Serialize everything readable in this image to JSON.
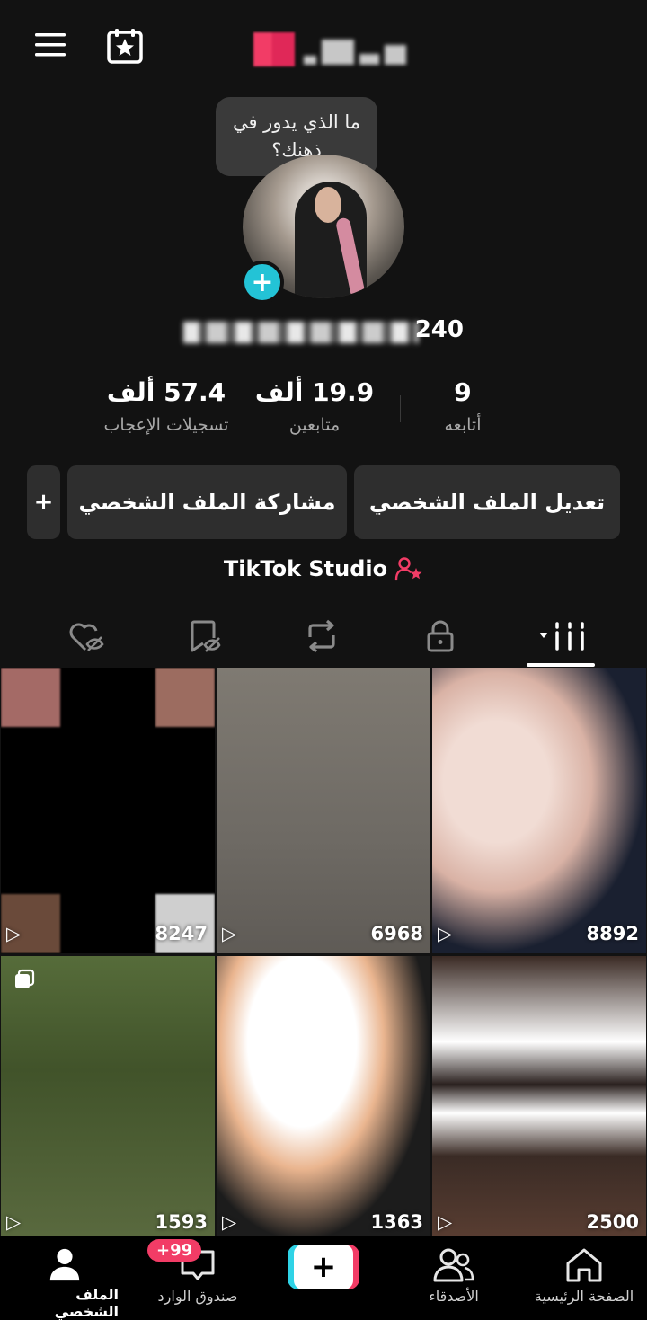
{
  "header": {
    "menu_icon": "hamburger-icon",
    "calendar_icon": "calendar-star-icon"
  },
  "profile": {
    "thought_bubble": "ما الذي يدور في ذهنك؟",
    "username_suffix": "240",
    "stats": [
      {
        "number": "9",
        "label": "أتابعه"
      },
      {
        "number": "19.9 ألف",
        "label": "متابعين"
      },
      {
        "number": "57.4 ألف",
        "label": "تسجيلات الإعجاب"
      }
    ],
    "buttons": {
      "edit": "تعديل الملف الشخصي",
      "share": "مشاركة الملف الشخصي",
      "more": "+"
    },
    "studio_label": "TikTok Studio"
  },
  "tabs": [
    {
      "name": "videos",
      "icon": "grid-bars-icon"
    },
    {
      "name": "private",
      "icon": "lock-icon"
    },
    {
      "name": "reposts",
      "icon": "repost-icon"
    },
    {
      "name": "favorites",
      "icon": "bookmark-hidden-icon"
    },
    {
      "name": "liked",
      "icon": "heart-hidden-icon"
    }
  ],
  "videos": [
    {
      "views": "8247"
    },
    {
      "views": "6968"
    },
    {
      "views": "8892"
    },
    {
      "views": "1593"
    },
    {
      "views": "1363"
    },
    {
      "views": "2500"
    }
  ],
  "bottom_nav": {
    "home": "الصفحة الرئيسية",
    "friends": "الأصدقاء",
    "inbox": "صندوق الوارد",
    "inbox_badge": "+99",
    "profile": "الملف الشخصي"
  },
  "colors": {
    "accent_pink": "#f23c66",
    "accent_cyan": "#2fd3e6",
    "background": "#121212"
  }
}
